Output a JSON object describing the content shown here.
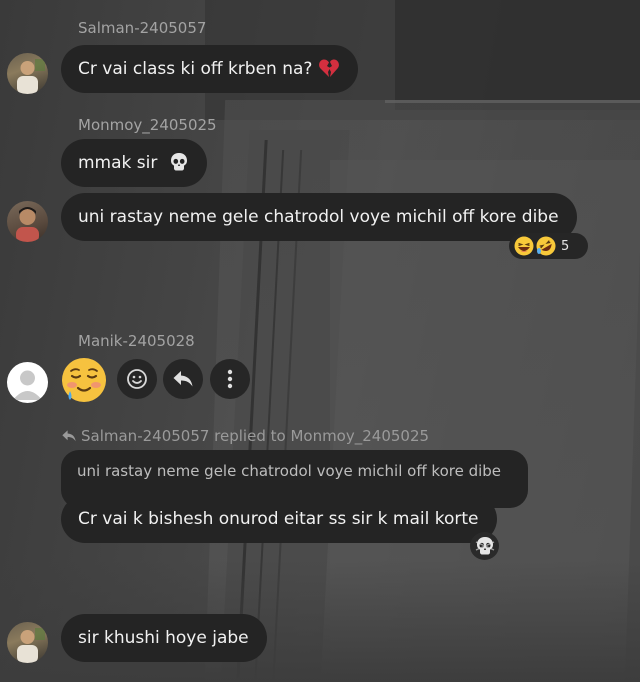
{
  "messages": [
    {
      "sender": "Salman-2405057",
      "text": "Cr vai class ki off krben na?"
    },
    {
      "sender": "Monmoy_2405025",
      "text": "mmak sir"
    },
    {
      "text": "uni rastay neme gele chatrodol voye michil off kore dibe",
      "reaction_count": "5"
    },
    {
      "sender": "Manik-2405028"
    },
    {
      "reply_header": "Salman-2405057 replied to Monmoy_2405025",
      "quoted_text": "uni rastay neme gele chatrodol voye michil off kore dibe",
      "text": "Cr vai k bishesh onurod eitar ss sir k mail korte"
    },
    {
      "text": "sir khushi hoye jabe"
    }
  ],
  "icons": [
    "broken-heart-icon",
    "skull-icon",
    "laughing-face-icon",
    "rolling-laughing-face-icon",
    "crying-smile-emoji",
    "smiley-icon",
    "reply-arrow-icon",
    "more-vertical-icon",
    "skull-icon"
  ],
  "colors": {
    "bubble": "#242424",
    "text": "#f1f1f1",
    "name": "#a3a3a3",
    "background": "#3c3c3c"
  }
}
